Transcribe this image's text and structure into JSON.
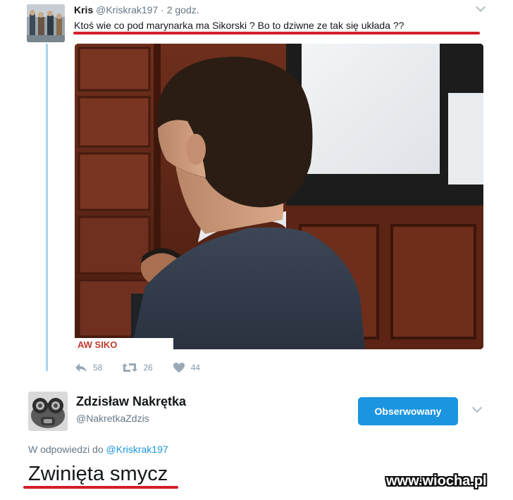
{
  "tweet1": {
    "name": "Kris",
    "handle": "@Kriskrak197",
    "separator": "·",
    "time": "2 godz.",
    "text": "Ktoś wie co pod marynarka ma Sikorski ? Bo to dziwne ze tak się układa ??",
    "image_overlay_text": "AW SIKO",
    "actions": {
      "reply_count": "58",
      "retweet_count": "26",
      "like_count": "44"
    }
  },
  "tweet2": {
    "name": "Zdzisław Nakrętka",
    "handle": "@NakretkaZdzis",
    "follow_button_label": "Obserwowany",
    "reply_prefix": "W odpowiedzi do",
    "reply_handle": "@Kriskrak197",
    "text": "Zwinięta smycz"
  },
  "watermark": "www.wiocha.pl",
  "icons": {
    "reply": "reply-icon",
    "retweet": "retweet-icon",
    "like": "heart-icon",
    "menu": "chevron-down-icon"
  },
  "colors": {
    "twitter_blue": "#1b95e0",
    "underline_red": "#d11f2a",
    "thread_line": "#a8d4ee",
    "muted_text": "#657786"
  }
}
